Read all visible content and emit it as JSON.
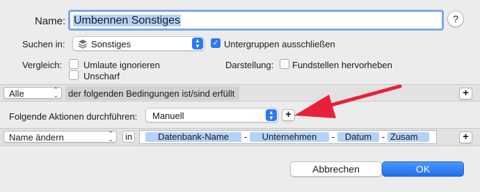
{
  "name": {
    "label": "Name:",
    "value": "Umbennen Sonstiges",
    "help": "?"
  },
  "search": {
    "label": "Suchen in:",
    "selected": "Sonstiges",
    "exclude_subgroups": {
      "label": "Untergruppen ausschließen",
      "checked": true
    }
  },
  "compare": {
    "label": "Vergleich:",
    "ignore_umlauts": {
      "label": "Umlaute ignorieren",
      "checked": false
    },
    "fuzzy": {
      "label": "Unscharf",
      "checked": false
    }
  },
  "display": {
    "label": "Darstellung:",
    "highlight": {
      "label": "Fundstellen hervorheben",
      "checked": false
    }
  },
  "conditions": {
    "match_selected": "Alle",
    "text": "der folgenden Bedingungen ist/sind erfüllt",
    "add": "+"
  },
  "actions": {
    "label": "Folgende Aktionen durchführen:",
    "selected": "Manuell",
    "add": "+"
  },
  "action_row": {
    "action_selected": "Name ändern",
    "in_label": "in",
    "tokens": [
      "Datenbank-Name",
      "Unternehmen",
      "Datum",
      "Zusam"
    ],
    "separator": "-",
    "add": "+"
  },
  "buttons": {
    "cancel": "Abbrechen",
    "ok": "OK"
  },
  "colors": {
    "accent": "#2a7af4",
    "token": "#b3d2f7",
    "arrow": "#e8203a"
  }
}
